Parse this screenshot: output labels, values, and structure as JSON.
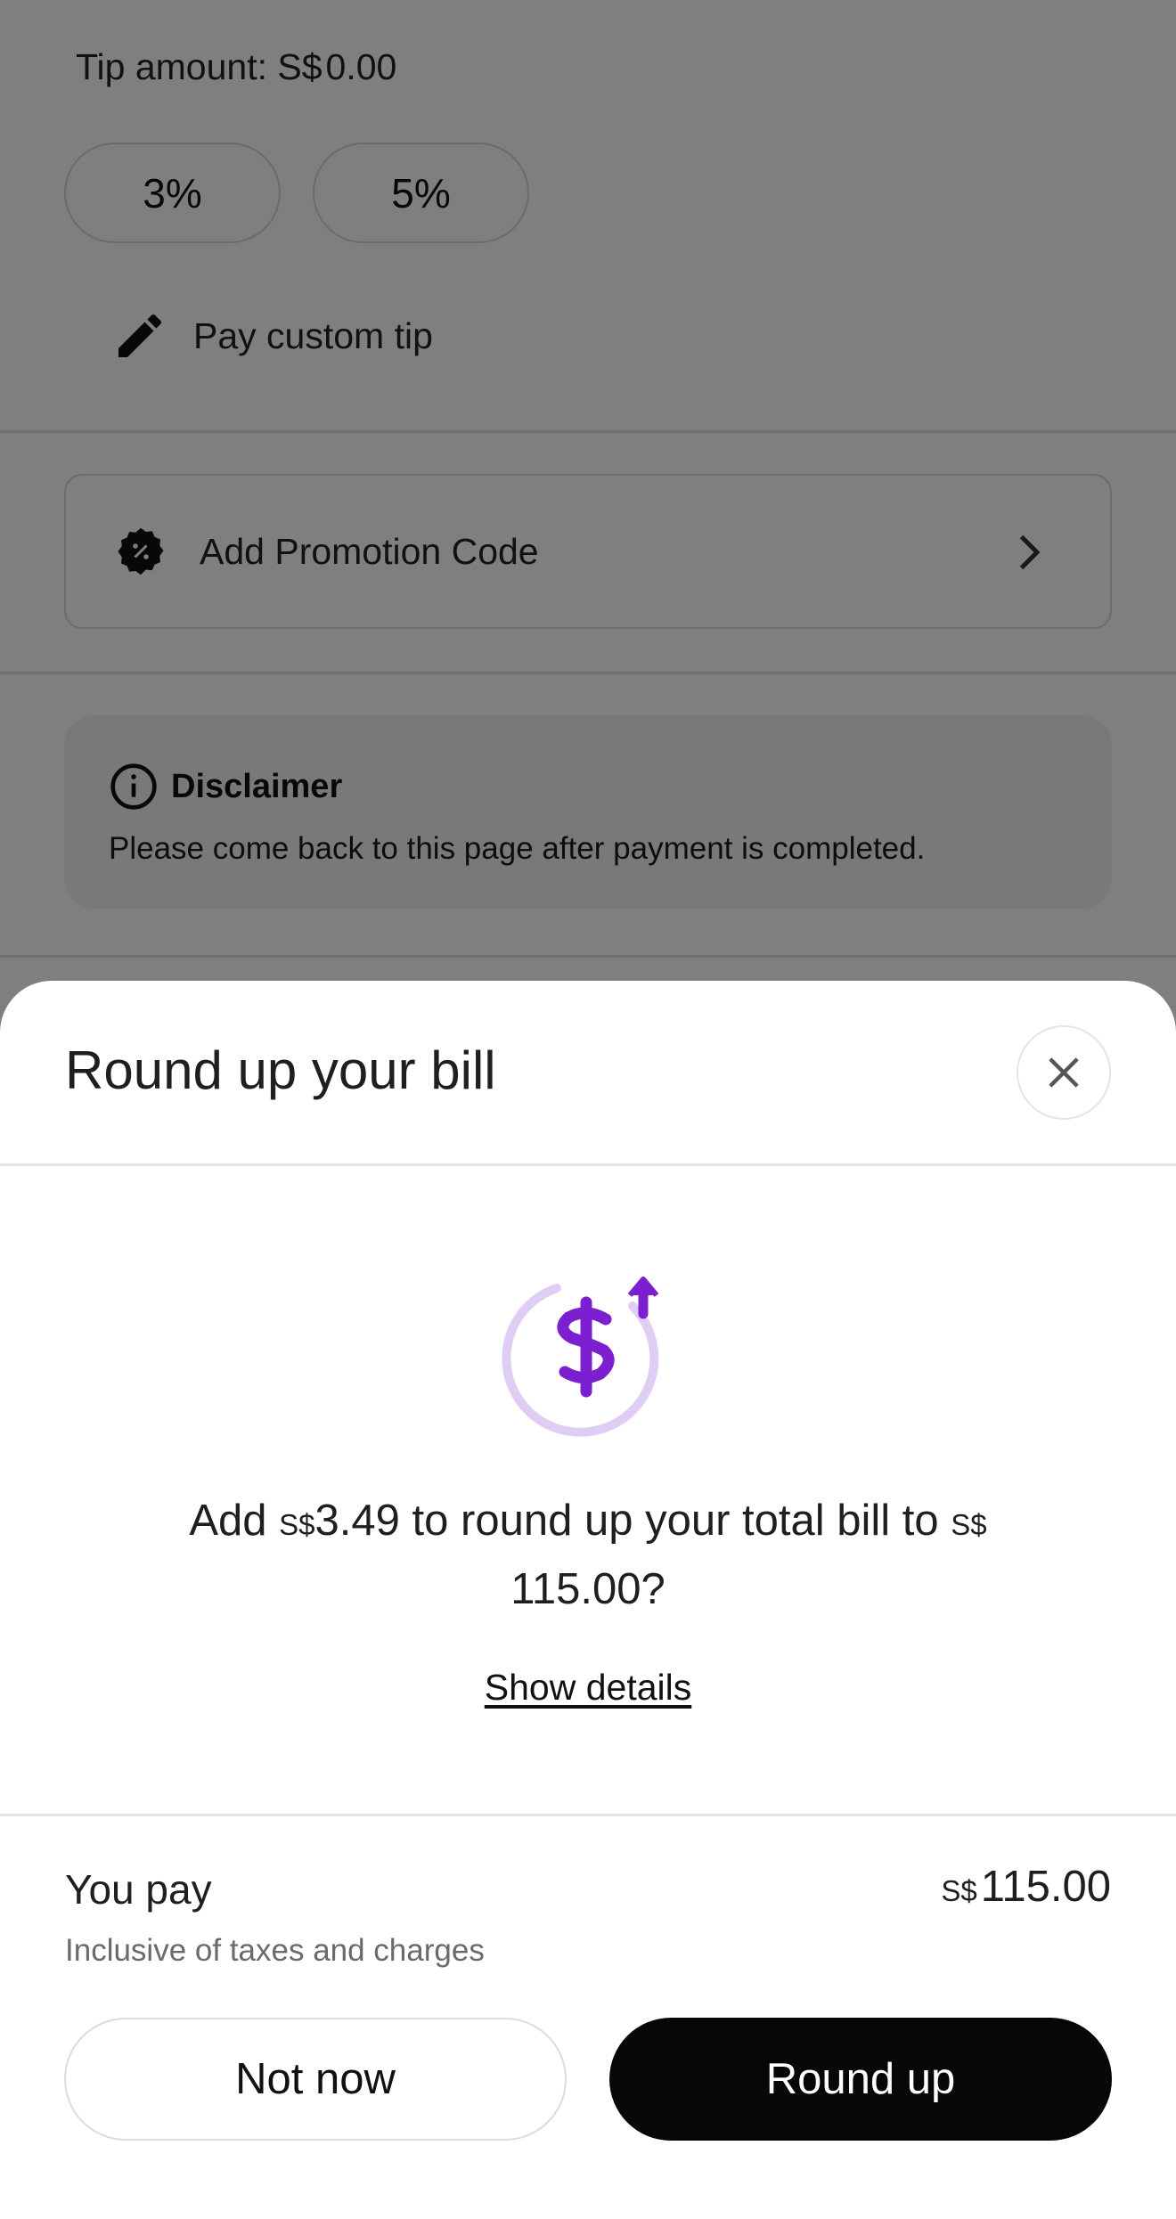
{
  "background": {
    "tip_amount_label": "Tip amount:",
    "tip_currency": "S$",
    "tip_value": "0.00",
    "tip_options": [
      "3%",
      "5%"
    ],
    "custom_tip_label": "Pay custom tip",
    "promo_label": "Add Promotion Code",
    "disclaimer_title": "Disclaimer",
    "disclaimer_text": "Please come back to this page after payment is completed."
  },
  "sheet": {
    "title": "Round up your bill",
    "message": {
      "prefix": "Add",
      "currency": "S$",
      "amount": "3.49",
      "middle": "to round up your total bill to",
      "currency2": "S$",
      "total": "115.00?"
    },
    "show_details": "Show details",
    "you_pay_label": "You pay",
    "inclusive_note": "Inclusive of taxes and charges",
    "total_currency": "S$",
    "total_value": "115.00",
    "not_now": "Not now",
    "round_up": "Round up"
  },
  "icons": {
    "edit": "pencil-icon",
    "promo": "promo-badge-icon",
    "chevron": "chevron-right-icon",
    "info": "info-icon",
    "close": "close-icon",
    "roundup": "dollar-roundup-icon"
  },
  "colors": {
    "accent_purple": "#7b1fd0",
    "accent_purple_light": "#e0cdf5",
    "primary_button": "#080606",
    "overlay": "rgba(0,0,0,0.5)"
  }
}
